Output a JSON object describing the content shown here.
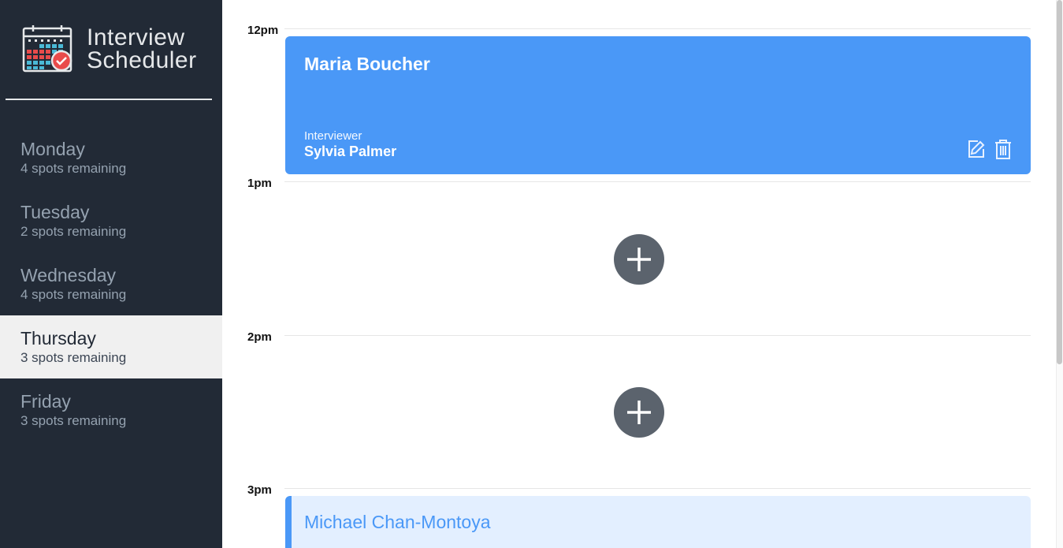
{
  "app": {
    "title_line1": "Interview",
    "title_line2": "Scheduler"
  },
  "sidebar": {
    "days": [
      {
        "name": "Monday",
        "spots": "4 spots remaining"
      },
      {
        "name": "Tuesday",
        "spots": "2 spots remaining"
      },
      {
        "name": "Wednesday",
        "spots": "4 spots remaining"
      },
      {
        "name": "Thursday",
        "spots": "3 spots remaining",
        "selected": true
      },
      {
        "name": "Friday",
        "spots": "3 spots remaining"
      }
    ]
  },
  "schedule": {
    "slots": [
      {
        "time": "12pm",
        "student": "Maria Boucher",
        "interviewer_label": "Interviewer",
        "interviewer": "Sylvia Palmer"
      },
      {
        "time": "1pm",
        "empty": true
      },
      {
        "time": "2pm",
        "empty": true
      },
      {
        "time": "3pm",
        "student": "Michael Chan-Montoya"
      }
    ]
  },
  "colors": {
    "sidebar_bg": "#222a36",
    "card_bg": "#4a98f7",
    "add_button_bg": "#5b636d",
    "selected_day_bg": "#f0f0f0",
    "light_card_bg": "#e3efff"
  },
  "icons": {
    "edit": "edit-icon",
    "delete": "trash-icon",
    "add": "plus-icon",
    "logo": "calendar-check-icon"
  }
}
